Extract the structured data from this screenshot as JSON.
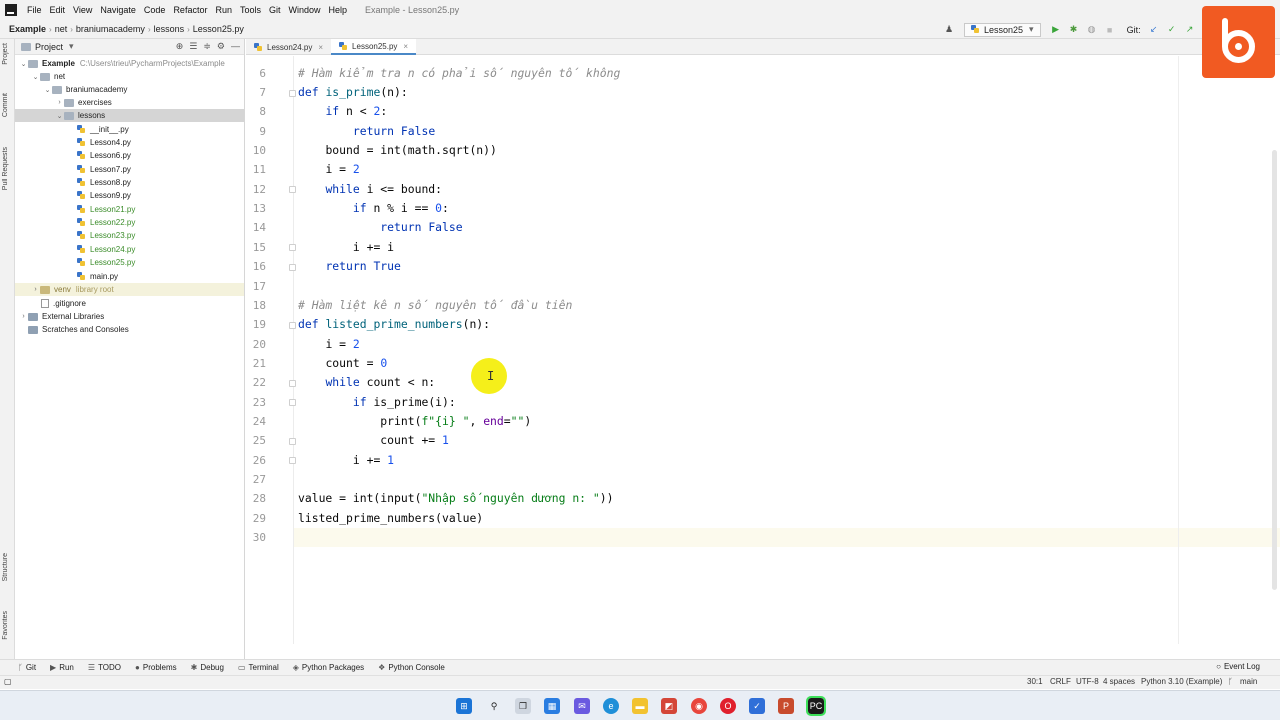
{
  "menubar": {
    "items": [
      "File",
      "Edit",
      "View",
      "Navigate",
      "Code",
      "Refactor",
      "Run",
      "Tools",
      "Git",
      "Window",
      "Help"
    ],
    "window_title": "Example - Lesson25.py"
  },
  "navbar": {
    "breadcrumbs": [
      "Example",
      "net",
      "braniumacademy",
      "lessons",
      "Lesson25.py"
    ],
    "run_config": "Lesson25",
    "git_label": "Git:"
  },
  "left_strip": {
    "project": "Project",
    "commit": "Commit",
    "pull_requests": "Pull Requests",
    "structure": "Structure",
    "favorites": "Favorites"
  },
  "project_panel": {
    "title": "Project",
    "tree": [
      {
        "label": "Example",
        "path": "C:\\Users\\trieu\\PycharmProjects\\Example"
      },
      {
        "label": "net"
      },
      {
        "label": "braniumacademy"
      },
      {
        "label": "exercises"
      },
      {
        "label": "lessons"
      },
      {
        "label": "__init__.py"
      },
      {
        "label": "Lesson4.py"
      },
      {
        "label": "Lesson6.py"
      },
      {
        "label": "Lesson7.py"
      },
      {
        "label": "Lesson8.py"
      },
      {
        "label": "Lesson9.py"
      },
      {
        "label": "Lesson21.py"
      },
      {
        "label": "Lesson22.py"
      },
      {
        "label": "Lesson23.py"
      },
      {
        "label": "Lesson24.py"
      },
      {
        "label": "Lesson25.py"
      },
      {
        "label": "main.py"
      },
      {
        "label": "venv",
        "path": "library root"
      },
      {
        "label": ".gitignore"
      },
      {
        "label": "External Libraries"
      },
      {
        "label": "Scratches and Consoles"
      }
    ]
  },
  "tabs": [
    {
      "label": "Lesson24.py"
    },
    {
      "label": "Lesson25.py"
    }
  ],
  "editor": {
    "line_numbers": [
      "6",
      "7",
      "8",
      "9",
      "10",
      "11",
      "12",
      "13",
      "14",
      "15",
      "16",
      "17",
      "18",
      "19",
      "20",
      "21",
      "22",
      "23",
      "24",
      "25",
      "26",
      "27",
      "28",
      "29",
      "30"
    ],
    "t": {
      "c1": "# Hàm kiểm tra n có phải số nguyên tố không",
      "def": "def",
      "is_prime": "is_prime",
      "paren_n_colon": "(n):",
      "if": "if",
      "while": "while",
      "return": "return",
      "false": "False",
      "true": "True",
      "n_lt": " n < ",
      "two": "2",
      "zero": "0",
      "one": "1",
      "colon": ":",
      "bound_eq": "bound = int(math.sqrt(n))",
      "i_eq": "i = ",
      "i_le_bound": " i <= bound:",
      "n_mod_i": " n % i == ",
      "i_pluseq_i": "i += i",
      "c2": "# Hàm liệt kê n số nguyên tố đầu tiên",
      "listed_fn": "listed_prime_numbers",
      "count_eq": "count = ",
      "count_lt_n": " count < n:",
      "is_prime_i": " is_prime(i):",
      "print_open": "print(",
      "fstr": "f\"{i} \"",
      "comma": ", ",
      "end_kw": "end",
      "eq": "=",
      "empty_str": "\"\"",
      "close_paren": ")",
      "count_pluseq": "count += ",
      "i_pluseq": "i += ",
      "value_open": "value = int(input(",
      "input_str": "\"Nhập số nguyên dương n: \"",
      "value_close": "))",
      "call_listed": "listed_prime_numbers(value)"
    }
  },
  "bottom_tools": [
    "Git",
    "Run",
    "TODO",
    "Problems",
    "Debug",
    "Terminal",
    "Python Packages",
    "Python Console"
  ],
  "event_log": "Event Log",
  "status": {
    "position": "30:1",
    "line_sep": "CRLF",
    "encoding": "UTF-8",
    "indent": "4 spaces",
    "interpreter": "Python 3.10 (Example)",
    "branch": "main"
  },
  "colors": {
    "brand": "#f15a22",
    "keyword": "#0033b3",
    "number": "#1750eb",
    "string": "#067d17",
    "comment": "#8c8c8c"
  }
}
